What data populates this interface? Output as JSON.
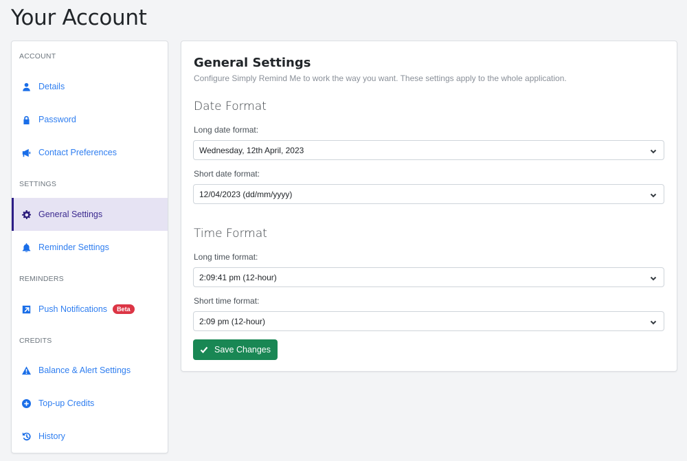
{
  "page": {
    "title": "Your Account"
  },
  "sidebar": {
    "sections": [
      {
        "label": "ACCOUNT"
      },
      {
        "label": "SETTINGS"
      },
      {
        "label": "REMINDERS"
      },
      {
        "label": "CREDITS"
      }
    ],
    "items": [
      {
        "label": "Details",
        "icon": "user-icon"
      },
      {
        "label": "Password",
        "icon": "lock-icon"
      },
      {
        "label": "Contact Preferences",
        "icon": "megaphone-icon"
      },
      {
        "label": "General Settings",
        "icon": "gear-icon",
        "active": true
      },
      {
        "label": "Reminder Settings",
        "icon": "bell-icon"
      },
      {
        "label": "Push Notifications",
        "icon": "external-link-square-icon",
        "badge": "Beta"
      },
      {
        "label": "Balance & Alert Settings",
        "icon": "warning-triangle-icon"
      },
      {
        "label": "Top-up Credits",
        "icon": "plus-circle-icon"
      },
      {
        "label": "History",
        "icon": "history-icon"
      }
    ]
  },
  "main": {
    "title": "General Settings",
    "description": "Configure Simply Remind Me to work the way you want. These settings apply to the whole application.",
    "date_format": {
      "heading": "Date Format",
      "long_label": "Long date format:",
      "long_value": "Wednesday, 12th April, 2023",
      "short_label": "Short date format:",
      "short_value": "12/04/2023 (dd/mm/yyyy)"
    },
    "time_format": {
      "heading": "Time Format",
      "long_label": "Long time format:",
      "long_value": "2:09:41 pm (12-hour)",
      "short_label": "Short time format:",
      "short_value": "2:09 pm (12-hour)"
    },
    "save_label": "Save Changes"
  },
  "colors": {
    "accent": "#2f7ef0",
    "active_bg": "#e6e3f3",
    "active_border": "#2d1d86",
    "save_button": "#198754",
    "badge": "#dc3545"
  }
}
